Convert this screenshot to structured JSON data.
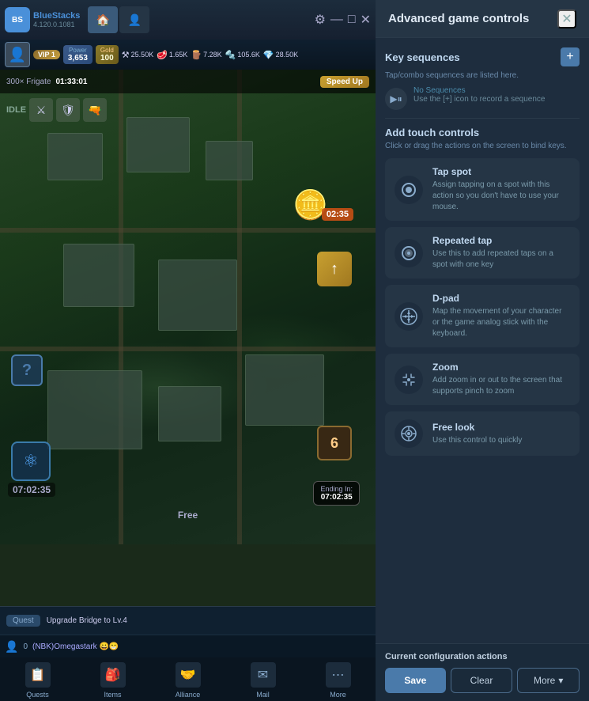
{
  "app": {
    "name": "BlueStacks",
    "version": "4.120.0.1081"
  },
  "top_bar": {
    "tabs": [
      {
        "icon": "🏠",
        "active": true
      },
      {
        "icon": "👤",
        "active": false
      }
    ],
    "controls": [
      "⚙",
      "—",
      "□",
      "✕"
    ]
  },
  "resources": {
    "vip_label": "VIP 1",
    "power_label": "Power",
    "power_value": "3,653",
    "gold_label": "Gold",
    "gold_value": "100",
    "res1": "25.50K",
    "res2": "1.65K",
    "res3": "7.28K",
    "res4": "105.6K",
    "res5": "28.50K"
  },
  "game": {
    "frigate_label": "300× Frigate",
    "frigate_timer": "01:33:01",
    "speed_up_label": "Speed Up",
    "idle_label": "IDLE",
    "timer_center": "02:35",
    "timer_bottom": "07:02:35",
    "ending_label": "Ending In:",
    "ending_time": "07:02:35",
    "free_label": "Free"
  },
  "bottom_nav": {
    "items": [
      {
        "label": "Quests",
        "icon": "📋",
        "badge": null
      },
      {
        "label": "Items",
        "icon": "🎒",
        "badge": null
      },
      {
        "label": "Alliance",
        "icon": "🤝",
        "badge": null
      },
      {
        "label": "Mail",
        "icon": "✉",
        "badge": null
      },
      {
        "label": "More",
        "icon": "⋯",
        "badge": null
      }
    ]
  },
  "quest_bar": {
    "quest_label": "Quest",
    "quest_text": "Upgrade Bridge to Lv.4"
  },
  "player_bar": {
    "score": "0",
    "name": "(NBK)Omegastark 😀😁"
  },
  "panel": {
    "title": "Advanced game controls",
    "close_icon": "✕",
    "key_sequences": {
      "title": "Key sequences",
      "subtitle": "Tap/combo sequences are listed here.",
      "add_icon": "+",
      "no_seq_label": "No Sequences",
      "no_seq_hint": "Use the [+] icon to record a sequence"
    },
    "add_touch_controls": {
      "title": "Add touch controls",
      "subtitle": "Click or drag the actions on the screen to bind keys."
    },
    "controls": [
      {
        "id": "tap-spot",
        "title": "Tap spot",
        "description": "Assign tapping on a spot with this action so you don't have to use your mouse.",
        "icon": "⚪"
      },
      {
        "id": "repeated-tap",
        "title": "Repeated tap",
        "description": "Use this to add repeated taps on a spot with one key",
        "icon": "⚫"
      },
      {
        "id": "d-pad",
        "title": "D-pad",
        "description": "Map the movement of your character or the game analog stick with the keyboard.",
        "icon": "✛"
      },
      {
        "id": "zoom",
        "title": "Zoom",
        "description": "Add zoom in or out to the screen that supports pinch to zoom",
        "icon": "👆"
      },
      {
        "id": "free-look",
        "title": "Free look",
        "description": "Use this control to quickly",
        "icon": "👁"
      }
    ],
    "footer": {
      "title": "Current configuration actions",
      "save_label": "Save",
      "clear_label": "Clear",
      "more_label": "More"
    }
  }
}
